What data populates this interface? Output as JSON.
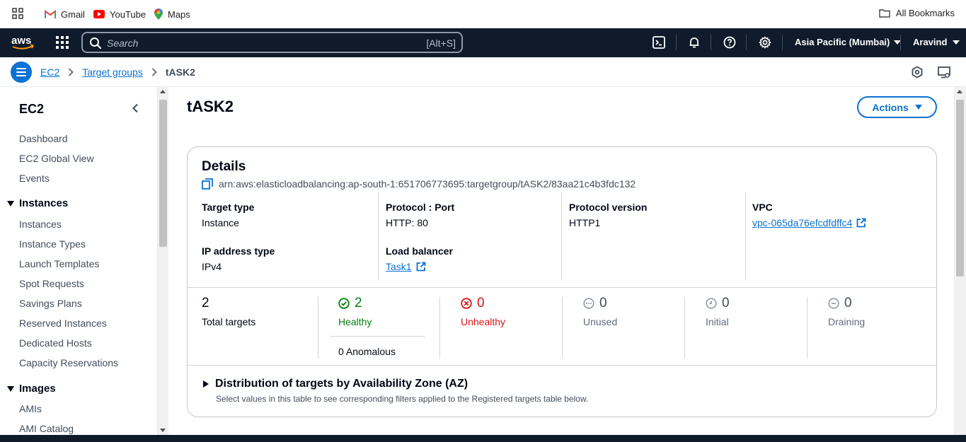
{
  "bookmarks": {
    "items": [
      {
        "label": "Gmail",
        "icon": "gmail-icon"
      },
      {
        "label": "YouTube",
        "icon": "youtube-icon"
      },
      {
        "label": "Maps",
        "icon": "maps-icon"
      }
    ],
    "all_label": "All Bookmarks"
  },
  "topnav": {
    "logo": "aws",
    "search_placeholder": "Search",
    "search_shortcut": "[Alt+S]",
    "region": "Asia Pacific (Mumbai)",
    "user": "Aravind"
  },
  "breadcrumb": {
    "items": [
      "EC2",
      "Target groups"
    ],
    "current": "tASK2"
  },
  "sidebar": {
    "title": "EC2",
    "top_links": [
      "Dashboard",
      "EC2 Global View",
      "Events"
    ],
    "sections": [
      {
        "title": "Instances",
        "items": [
          "Instances",
          "Instance Types",
          "Launch Templates",
          "Spot Requests",
          "Savings Plans",
          "Reserved Instances",
          "Dedicated Hosts",
          "Capacity Reservations"
        ]
      },
      {
        "title": "Images",
        "items": [
          "AMIs",
          "AMI Catalog"
        ]
      }
    ]
  },
  "main": {
    "title": "tASK2",
    "actions_label": "Actions",
    "details": {
      "heading": "Details",
      "arn": "arn:aws:elasticloadbalancing:ap-south-1:651706773695:targetgroup/tASK2/83aa21c4b3fdc132",
      "fields": {
        "target_type": {
          "label": "Target type",
          "value": "Instance"
        },
        "ip_address_type": {
          "label": "IP address type",
          "value": "IPv4"
        },
        "protocol_port": {
          "label": "Protocol : Port",
          "value": "HTTP: 80"
        },
        "load_balancer": {
          "label": "Load balancer",
          "value": "Task1"
        },
        "protocol_version": {
          "label": "Protocol version",
          "value": "HTTP1"
        },
        "vpc": {
          "label": "VPC",
          "value": "vpc-065da76efcdfdffc4"
        }
      },
      "stats": {
        "total": {
          "value": "2",
          "label": "Total targets"
        },
        "healthy": {
          "value": "2",
          "label": "Healthy",
          "color": "#037f0c"
        },
        "anomalous": "0 Anomalous",
        "unhealthy": {
          "value": "0",
          "label": "Unhealthy",
          "color": "#d91515"
        },
        "unused": {
          "value": "0",
          "label": "Unused"
        },
        "initial": {
          "value": "0",
          "label": "Initial"
        },
        "draining": {
          "value": "0",
          "label": "Draining"
        }
      },
      "distribution": {
        "title": "Distribution of targets by Availability Zone (AZ)",
        "subtitle": "Select values in this table to see corresponding filters applied to the Registered targets table below."
      }
    }
  },
  "colors": {
    "link": "#0972d3",
    "nav_bg": "#0f1b2a",
    "healthy": "#037f0c",
    "unhealthy": "#d91515",
    "muted": "#5f6b7a"
  }
}
